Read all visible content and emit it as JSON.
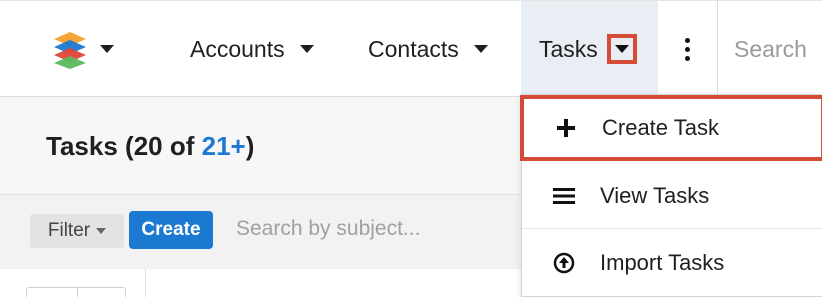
{
  "nav": {
    "logo_icon": "stacked-layers-logo",
    "logo_colors": [
      "#f3a536",
      "#1b79d1",
      "#e0443a",
      "#5cb85c"
    ],
    "accounts_label": "Accounts",
    "contacts_label": "Contacts",
    "tasks_label": "Tasks",
    "more_icon": "kebab-menu-icon",
    "search_placeholder": "Search"
  },
  "header": {
    "title": "Tasks",
    "count_prefix": "(20 of ",
    "count_link": "21+",
    "count_suffix": ")"
  },
  "filter_bar": {
    "filter_label": "Filter",
    "create_label": "Create",
    "search_placeholder": "Search by subject..."
  },
  "dropdown": {
    "items": [
      {
        "label": "Create Task",
        "icon": "plus-icon",
        "highlighted": true
      },
      {
        "label": "View Tasks",
        "icon": "list-icon",
        "highlighted": false
      },
      {
        "label": "Import Tasks",
        "icon": "upload-circle-icon",
        "highlighted": false
      }
    ]
  },
  "colors": {
    "highlight_border": "#d64b38",
    "link_blue": "#1b79d1",
    "active_tab_bg": "#e9eef4"
  }
}
